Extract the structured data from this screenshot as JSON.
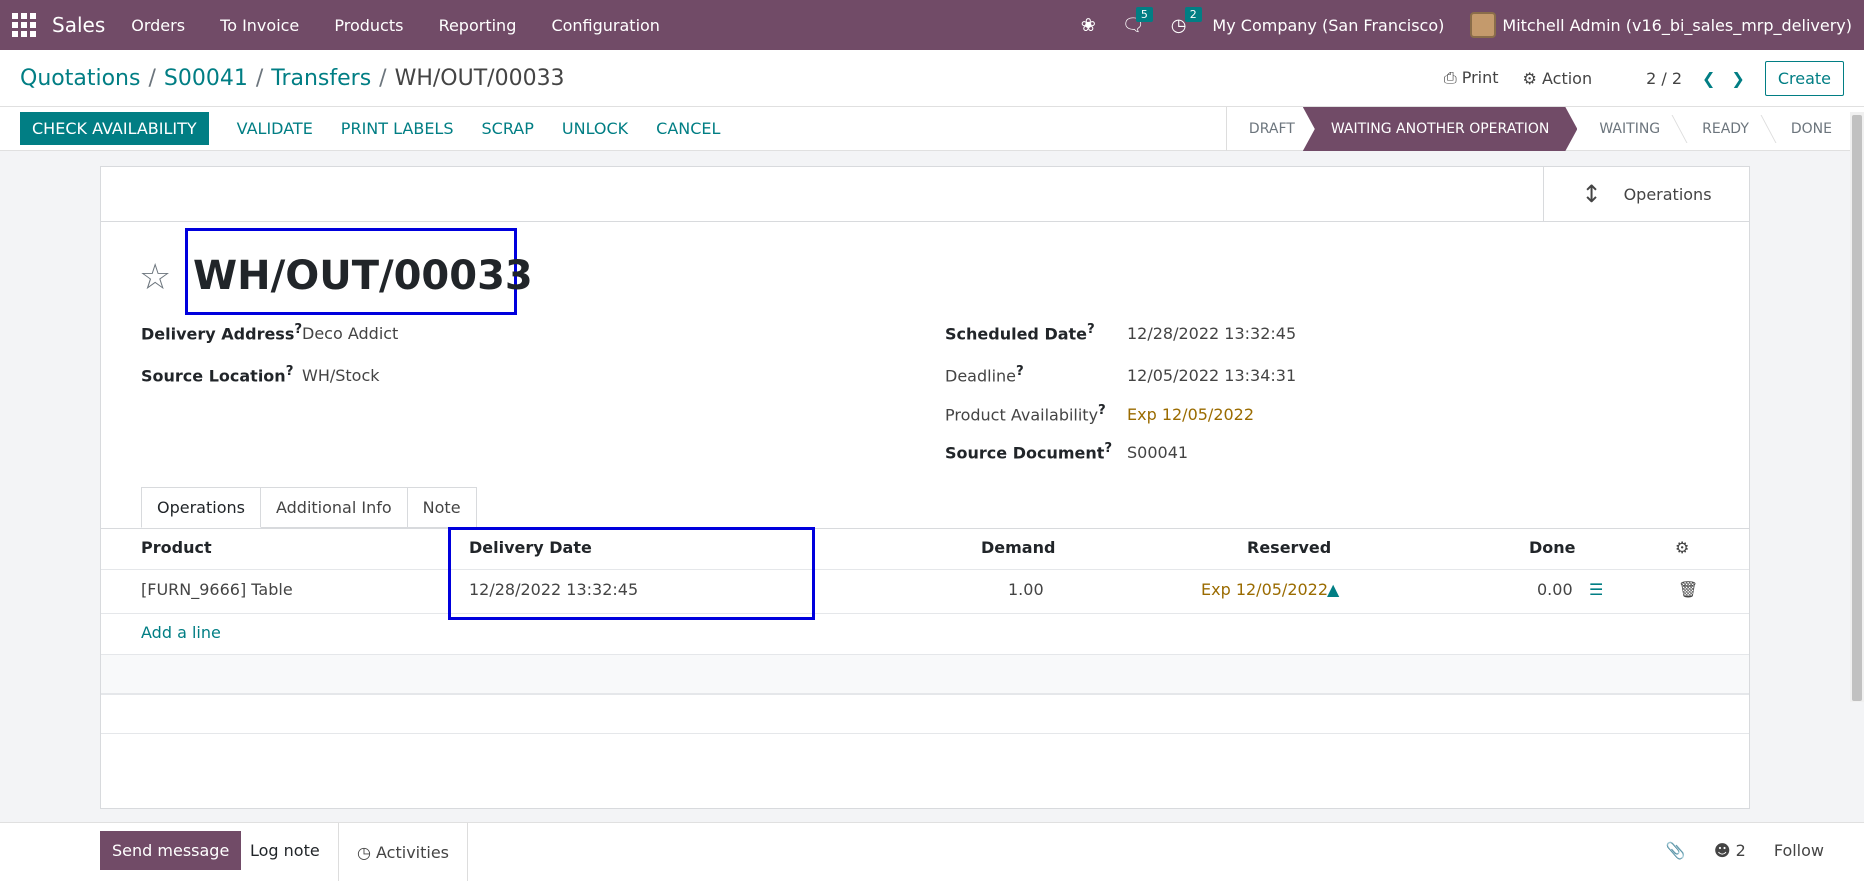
{
  "topbar": {
    "app_name": "Sales",
    "menu": [
      "Orders",
      "To Invoice",
      "Products",
      "Reporting",
      "Configuration"
    ],
    "bug_icon": "bug-icon",
    "messages_count": "5",
    "activities_count": "2",
    "company": "My Company (San Francisco)",
    "user": "Mitchell Admin (v16_bi_sales_mrp_delivery)"
  },
  "breadcrumb": {
    "items": [
      "Quotations",
      "S00041",
      "Transfers"
    ],
    "current": "WH/OUT/00033"
  },
  "control": {
    "print": "Print",
    "action": "Action",
    "pager": "2 / 2",
    "create": "Create"
  },
  "statusbar": {
    "buttons": [
      "CHECK AVAILABILITY",
      "VALIDATE",
      "PRINT LABELS",
      "SCRAP",
      "UNLOCK",
      "CANCEL"
    ],
    "stages": [
      "DRAFT",
      "WAITING ANOTHER OPERATION",
      "WAITING",
      "READY",
      "DONE"
    ],
    "active_stage": "WAITING ANOTHER OPERATION"
  },
  "smart_button": {
    "label": "Operations"
  },
  "record": {
    "name": "WH/OUT/00033",
    "delivery_address_label": "Delivery Address",
    "delivery_address": "Deco Addict",
    "source_location_label": "Source Location",
    "source_location": "WH/Stock",
    "scheduled_date_label": "Scheduled Date",
    "scheduled_date": "12/28/2022 13:32:45",
    "deadline_label": "Deadline",
    "deadline": "12/05/2022 13:34:31",
    "availability_label": "Product Availability",
    "availability": "Exp 12/05/2022",
    "source_document_label": "Source Document",
    "source_document": "S00041",
    "help_mark": "?"
  },
  "tabs": [
    "Operations",
    "Additional Info",
    "Note"
  ],
  "table": {
    "headers": [
      "Product",
      "Delivery Date",
      "Demand",
      "Reserved",
      "Done"
    ],
    "rows": [
      {
        "product": "[FURN_9666] Table",
        "delivery_date": "12/28/2022 13:32:45",
        "demand": "1.00",
        "reserved": "Exp 12/05/2022",
        "done": "0.00"
      }
    ],
    "add_line": "Add a line"
  },
  "chatter": {
    "send_message": "Send message",
    "log_note": "Log note",
    "activities": "Activities",
    "followers": "2",
    "follow": "Follow"
  },
  "colors": {
    "brand": "#714b67",
    "accent": "#017e84",
    "highlight_box": "#0000dd"
  }
}
